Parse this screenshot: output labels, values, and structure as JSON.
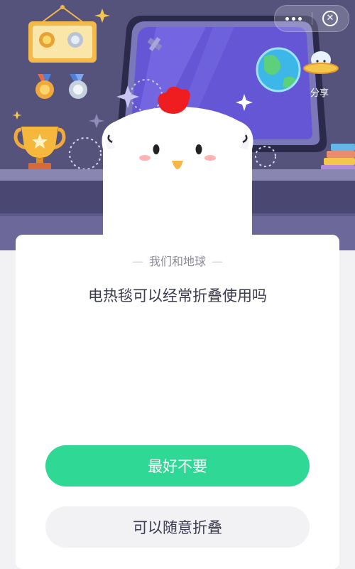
{
  "capsule": {
    "more_icon": "more-dots-icon",
    "close_icon": "close-circle-icon",
    "close_glyph": "✕"
  },
  "share": {
    "label": "分享",
    "icon": "ufo-share-icon"
  },
  "quiz": {
    "category": "我们和地球",
    "question": "电热毯可以经常折叠使用吗",
    "options": [
      "最好不要",
      "可以随意折叠"
    ]
  },
  "colors": {
    "primary_button": "#2fd894",
    "secondary_button": "#f2f2f5",
    "scene_background": "#53507a"
  }
}
